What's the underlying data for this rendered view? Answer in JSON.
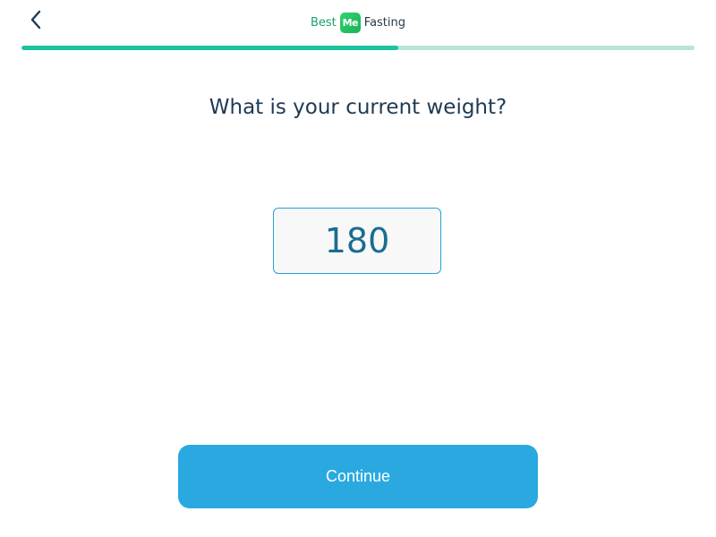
{
  "header": {
    "back_icon": "chevron-left-icon",
    "brand_prefix": "Best",
    "brand_logo_text": "Me",
    "brand_suffix": "Fasting",
    "progress_fraction": 0.56
  },
  "main": {
    "question": "What is your current weight?",
    "weight_value": "180"
  },
  "footer": {
    "continue_label": "Continue"
  },
  "colors": {
    "accent": "#1cc39c",
    "track": "#b6e5d8",
    "button": "#2aa9e0",
    "title": "#1e3a52",
    "value": "#1a6d90"
  }
}
